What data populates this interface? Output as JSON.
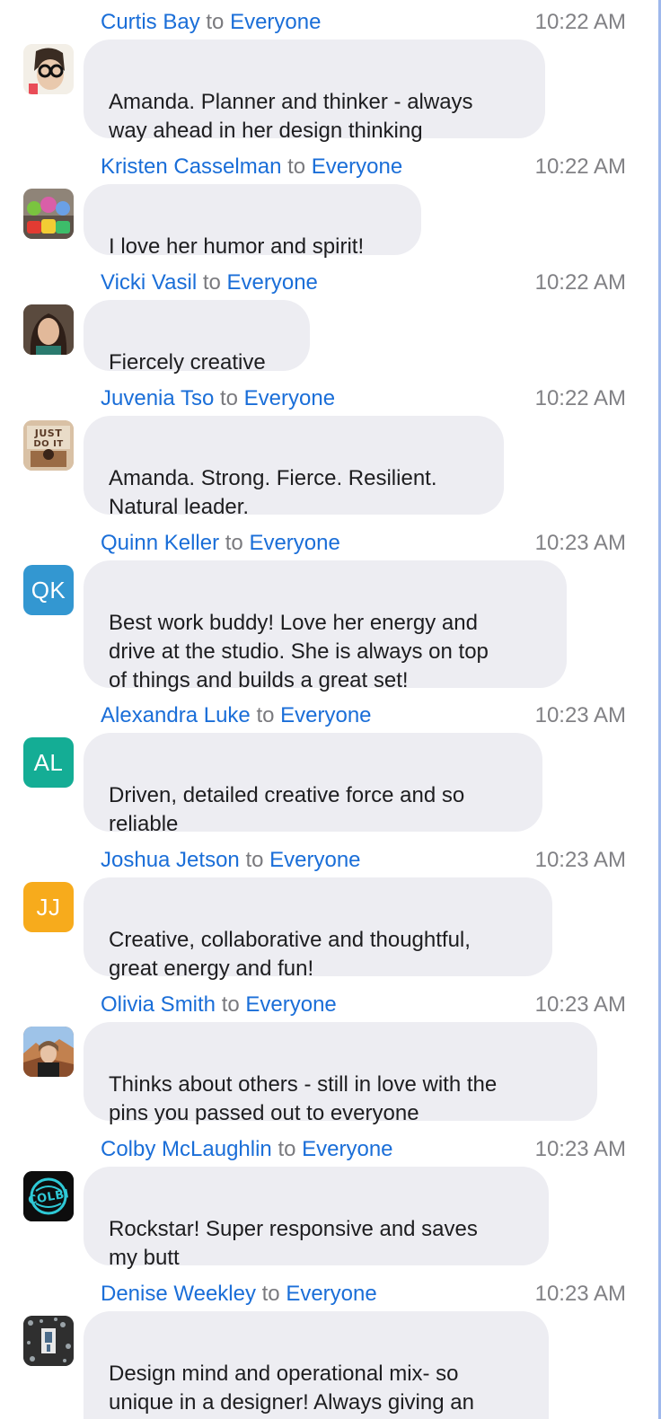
{
  "chat": {
    "messages": [
      {
        "sender": "Curtis Bay",
        "to_word": "to",
        "recipient": "Everyone",
        "time": "10:22 AM",
        "text": "Amanda. Planner and thinker - always\nway ahead in her design thinking",
        "avatar": {
          "type": "photo",
          "icon": "glasses-portrait-icon",
          "color": "#f4f1ea"
        }
      },
      {
        "sender": "Kristen Casselman",
        "to_word": "to",
        "recipient": "Everyone",
        "time": "10:22 AM",
        "text": "I love her humor and spirit!",
        "avatar": {
          "type": "photo",
          "icon": "toys-photo-icon",
          "color": "#b0a396"
        }
      },
      {
        "sender": "Vicki Vasil",
        "to_word": "to",
        "recipient": "Everyone",
        "time": "10:22 AM",
        "text": "Fiercely creative",
        "avatar": {
          "type": "photo",
          "icon": "portrait-photo-icon",
          "color": "#4a3a32"
        }
      },
      {
        "sender": "Juvenia Tso",
        "to_word": "to",
        "recipient": "Everyone",
        "time": "10:22 AM",
        "text": "Amanda. Strong. Fierce. Resilient.\nNatural leader.",
        "avatar": {
          "type": "photo",
          "icon": "just-do-it-photo-icon",
          "color": "#caa98a"
        }
      },
      {
        "sender": "Quinn Keller",
        "to_word": "to",
        "recipient": "Everyone",
        "time": "10:23 AM",
        "text": "Best work buddy! Love her energy and\ndrive at the studio. She is always on top\nof things and builds a great set!",
        "avatar": {
          "type": "initials",
          "initials": "QK",
          "color": "#3397d1"
        }
      },
      {
        "sender": "Alexandra Luke",
        "to_word": "to",
        "recipient": "Everyone",
        "time": "10:23 AM",
        "text": "Driven, detailed creative force and so\nreliable",
        "avatar": {
          "type": "initials",
          "initials": "AL",
          "color": "#14ad95"
        }
      },
      {
        "sender": "Joshua Jetson",
        "to_word": "to",
        "recipient": "Everyone",
        "time": "10:23 AM",
        "text": "Creative, collaborative and thoughtful,\ngreat energy and fun!",
        "avatar": {
          "type": "initials",
          "initials": "JJ",
          "color": "#f7ab1c"
        }
      },
      {
        "sender": "Olivia Smith",
        "to_word": "to",
        "recipient": "Everyone",
        "time": "10:23 AM",
        "text": "Thinks about others - still in love with the\npins you passed out to everyone",
        "avatar": {
          "type": "photo",
          "icon": "canyon-portrait-icon",
          "color": "#b67b55"
        }
      },
      {
        "sender": "Colby McLaughlin",
        "to_word": "to",
        "recipient": "Everyone",
        "time": "10:23 AM",
        "text": "Rockstar! Super responsive and saves\nmy butt",
        "avatar": {
          "type": "photo",
          "icon": "colby-logo-icon",
          "color": "#111111"
        }
      },
      {
        "sender": "Denise Weekley",
        "to_word": "to",
        "recipient": "Everyone",
        "time": "10:23 AM",
        "text": "Design mind and operational mix- so\nunique in a designer! Always giving an\nextra effort",
        "avatar": {
          "type": "photo",
          "icon": "pattern-photo-icon",
          "color": "#2d2d2d"
        }
      }
    ]
  }
}
